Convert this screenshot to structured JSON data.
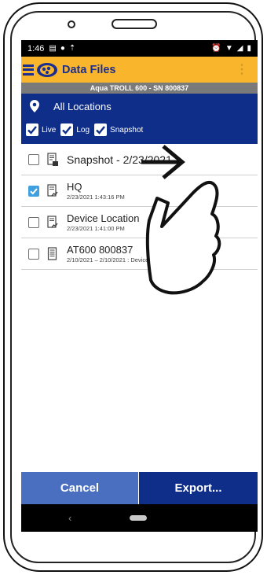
{
  "status_bar": {
    "time": "1:46"
  },
  "app_bar": {
    "title": "Data Files"
  },
  "device_bar": {
    "label": "Aqua TROLL 600 - SN 800837"
  },
  "location": {
    "label": "All Locations"
  },
  "filters": [
    {
      "label": "Live",
      "checked": true
    },
    {
      "label": "Log",
      "checked": true
    },
    {
      "label": "Snapshot",
      "checked": true
    }
  ],
  "files": [
    {
      "name": "Snapshot - 2/23/2021",
      "sub": "",
      "checked": false,
      "icon": "snapshot-file-icon"
    },
    {
      "name": "HQ",
      "sub": "2/23/2021 1:43:16 PM",
      "checked": true,
      "icon": "log-file-icon"
    },
    {
      "name": "Device Location",
      "sub": "2/23/2021 1:41:00 PM",
      "checked": false,
      "icon": "log-file-icon"
    },
    {
      "name": "AT600 800837",
      "sub": "2/10/2021 – 2/10/2021 : Device Location",
      "checked": false,
      "icon": "document-icon"
    }
  ],
  "buttons": {
    "cancel": "Cancel",
    "export": "Export..."
  },
  "nav": {
    "back": "‹"
  },
  "colors": {
    "app_bar": "#f9b52b",
    "header_blue": "#0e2e8a",
    "cancel_blue": "#4a6fc0",
    "check_blue": "#3fa0e0",
    "device_bar_gray": "#7a7a7a"
  }
}
